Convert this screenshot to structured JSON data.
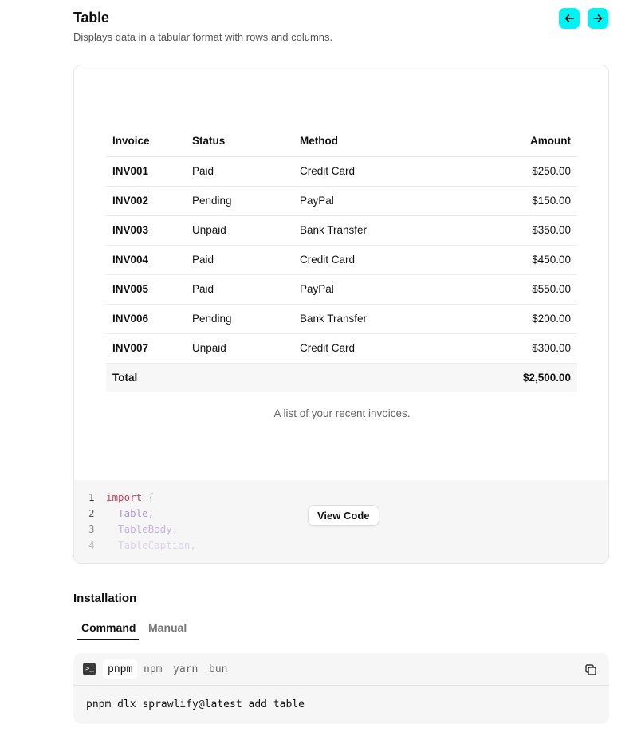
{
  "header": {
    "title": "Table",
    "description": "Displays data in a tabular format with rows and columns.",
    "prev_icon": "arrow-left-icon",
    "next_icon": "arrow-right-icon",
    "accent_color": "#00f3f3"
  },
  "table": {
    "columns": [
      "Invoice",
      "Status",
      "Method",
      "Amount"
    ],
    "rows": [
      {
        "invoice": "INV001",
        "status": "Paid",
        "method": "Credit Card",
        "amount": "$250.00"
      },
      {
        "invoice": "INV002",
        "status": "Pending",
        "method": "PayPal",
        "amount": "$150.00"
      },
      {
        "invoice": "INV003",
        "status": "Unpaid",
        "method": "Bank Transfer",
        "amount": "$350.00"
      },
      {
        "invoice": "INV004",
        "status": "Paid",
        "method": "Credit Card",
        "amount": "$450.00"
      },
      {
        "invoice": "INV005",
        "status": "Paid",
        "method": "PayPal",
        "amount": "$550.00"
      },
      {
        "invoice": "INV006",
        "status": "Pending",
        "method": "Bank Transfer",
        "amount": "$200.00"
      },
      {
        "invoice": "INV007",
        "status": "Unpaid",
        "method": "Credit Card",
        "amount": "$300.00"
      }
    ],
    "footer": {
      "label": "Total",
      "amount": "$2,500.00"
    },
    "caption": "A list of your recent invoices."
  },
  "code_preview": {
    "lines": [
      {
        "number": "1",
        "keyword": "import",
        "punct": " {",
        "ident": ""
      },
      {
        "number": "2",
        "keyword": "",
        "punct": "",
        "ident": "  Table,"
      },
      {
        "number": "3",
        "keyword": "",
        "punct": "",
        "ident": "  TableBody,"
      },
      {
        "number": "4",
        "keyword": "",
        "punct": "",
        "ident": "  TableCaption,"
      }
    ],
    "view_code_label": "View Code"
  },
  "installation": {
    "title": "Installation",
    "tabs": [
      "Command",
      "Manual"
    ],
    "active_tab": "Command",
    "terminal_icon": "terminal-icon",
    "package_managers": [
      "pnpm",
      "npm",
      "yarn",
      "bun"
    ],
    "active_package_manager": "pnpm",
    "copy_icon": "copy-icon",
    "command": "pnpm dlx sprawlify@latest add table"
  }
}
